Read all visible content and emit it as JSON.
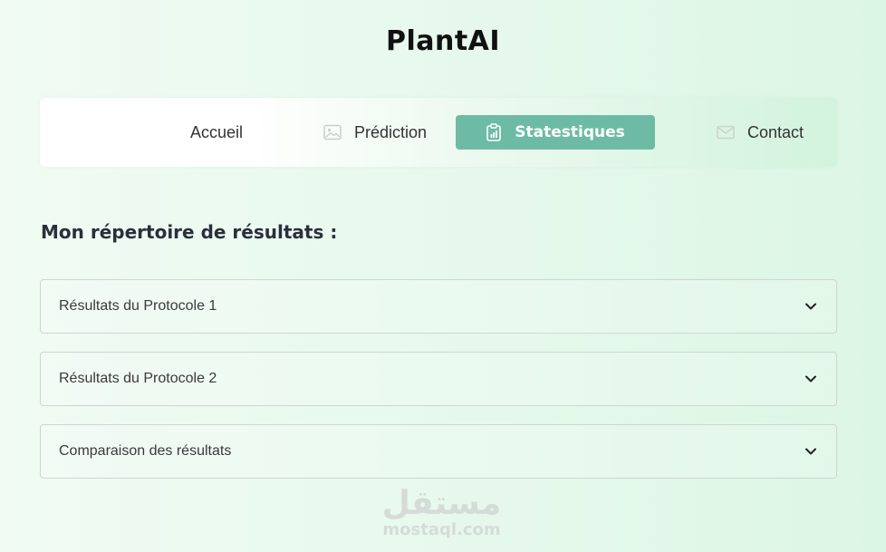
{
  "app": {
    "title": "PlantAI"
  },
  "nav": {
    "items": [
      {
        "label": "Accueil",
        "icon": "none"
      },
      {
        "label": "Prédiction",
        "icon": "image-icon"
      },
      {
        "label": "Statestiques",
        "icon": "clipboard-chart-icon",
        "active": true
      },
      {
        "label": "Contact",
        "icon": "envelope-icon"
      }
    ]
  },
  "section": {
    "title": "Mon répertoire de résultats :"
  },
  "accordion": [
    {
      "label": "Résultats du Protocole 1"
    },
    {
      "label": "Résultats du Protocole 2"
    },
    {
      "label": "Comparaison des résultats"
    }
  ],
  "watermark": {
    "arabic": "مستقل",
    "latin": "mostaql.com"
  },
  "colors": {
    "accent": "#6dbba4",
    "title": "#2b2f3c",
    "border": "#cfd6d2"
  }
}
